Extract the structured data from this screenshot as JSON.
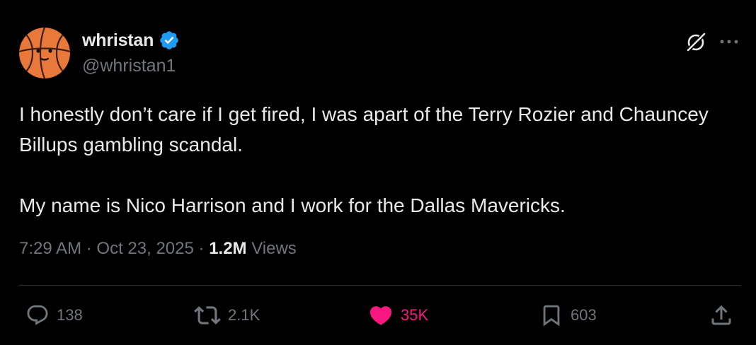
{
  "author": {
    "display_name": "whristan",
    "handle": "@whristan1",
    "verified": true
  },
  "tweet": {
    "paragraphs": [
      "I honestly don’t care if I get fired, I was apart of the Terry Rozier and Chauncey Billups gambling scandal.",
      "My name is Nico Harrison and I work for the Dallas Mavericks."
    ]
  },
  "meta": {
    "time": "7:29 AM",
    "date": "Oct 23, 2025",
    "separator": "·",
    "views_count": "1.2M",
    "views_label": "Views"
  },
  "actions": {
    "replies": "138",
    "reposts": "2.1K",
    "likes": "35K",
    "bookmarks": "603"
  },
  "colors": {
    "background": "#000000",
    "text": "#e7e9ea",
    "secondary": "#71767b",
    "verified": "#1d9bf0",
    "like": "#f91880",
    "divider": "#2f3336"
  },
  "icons": {
    "grok": "grok-icon",
    "more": "more-icon",
    "reply": "reply-icon",
    "repost": "repost-icon",
    "like": "heart-icon",
    "bookmark": "bookmark-icon",
    "share": "share-icon",
    "verified": "verified-badge-icon",
    "avatar": "basketball-face-avatar"
  }
}
